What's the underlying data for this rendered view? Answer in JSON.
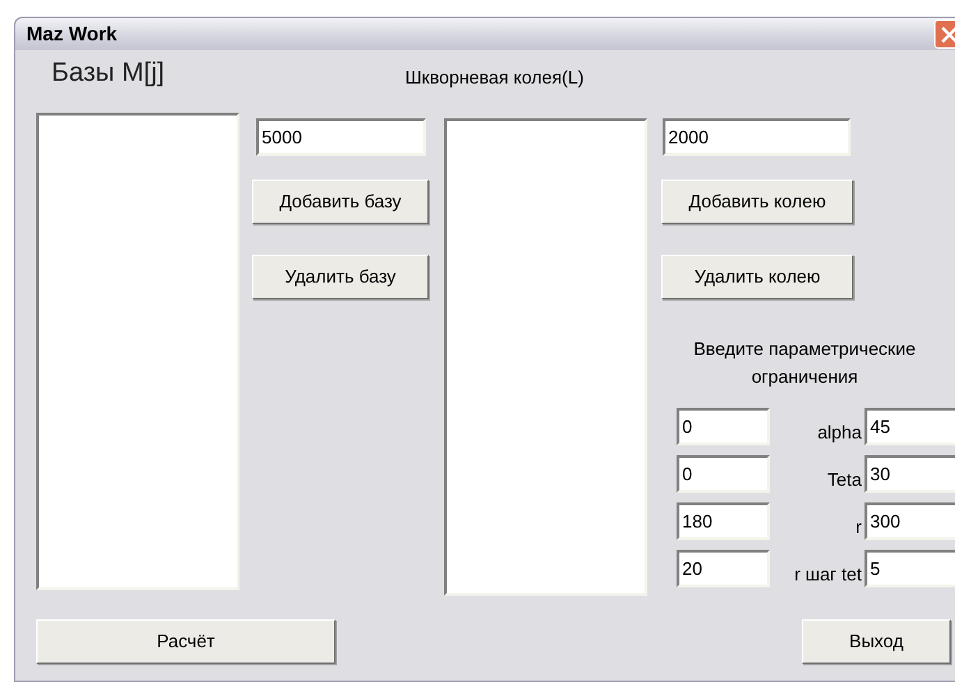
{
  "window": {
    "title": "Maz Work"
  },
  "bases": {
    "label": "Базы M[j]",
    "value": "5000",
    "add_button": "Добавить базу",
    "remove_button": "Удалить базу"
  },
  "track": {
    "label": "Шкворневая колея(L)",
    "value": "2000",
    "add_button": "Добавить колею",
    "remove_button": "Удалить колею"
  },
  "constraints": {
    "title": "Введите параметрические ограничения",
    "rows": [
      {
        "min": "0",
        "label": "alpha",
        "max": "45"
      },
      {
        "min": "0",
        "label": "Teta",
        "max": "30"
      },
      {
        "min": "180",
        "label": "r",
        "max": "300"
      },
      {
        "min": "20",
        "label": "r шаг tet",
        "max": "5"
      }
    ]
  },
  "buttons": {
    "calculate": "Расчёт",
    "exit": "Выход"
  }
}
